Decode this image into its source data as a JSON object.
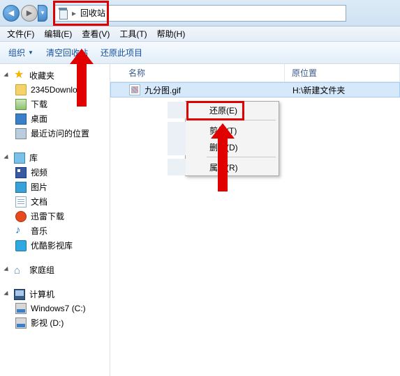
{
  "addressbar": {
    "crumb": "回收站"
  },
  "menubar": {
    "file": "文件(F)",
    "edit": "编辑(E)",
    "view": "查看(V)",
    "tools": "工具(T)",
    "help": "帮助(H)"
  },
  "toolbar": {
    "organize": "组织",
    "empty": "清空回收站",
    "restore": "还原此项目"
  },
  "nav": {
    "favorites": {
      "label": "收藏夹",
      "items": [
        {
          "label": "2345Downloa"
        },
        {
          "label": "下载"
        },
        {
          "label": "桌面"
        },
        {
          "label": "最近访问的位置"
        }
      ]
    },
    "libraries": {
      "label": "库",
      "items": [
        {
          "label": "视频"
        },
        {
          "label": "图片"
        },
        {
          "label": "文档"
        },
        {
          "label": "迅雷下载"
        },
        {
          "label": "音乐"
        },
        {
          "label": "优酷影视库"
        }
      ]
    },
    "homegroup": {
      "label": "家庭组"
    },
    "computer": {
      "label": "计算机",
      "items": [
        {
          "label": "Windows7 (C:)"
        },
        {
          "label": "影视 (D:)"
        }
      ]
    }
  },
  "columns": {
    "name": "名称",
    "location": "原位置"
  },
  "files": [
    {
      "name": "九分图.gif",
      "location": "H:\\新建文件夹"
    }
  ],
  "contextmenu": {
    "restore": "还原(E)",
    "cut": "剪切(T)",
    "delete": "删除(D)",
    "properties": "属性(R)"
  }
}
